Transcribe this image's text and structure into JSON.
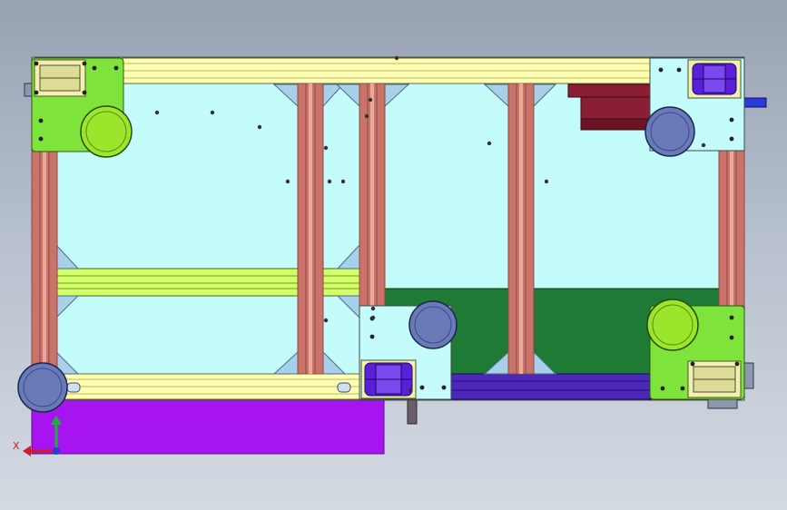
{
  "viewport": {
    "background_top": "#98a2b3",
    "background_bottom": "#d4dae2"
  },
  "model": {
    "view": "top",
    "colors": {
      "plate_cyan": "#c4fbfb",
      "rail_yellow": "#ffffb4",
      "rail_yellow_edge": "#b8b860",
      "crossbar_green": "#d3ff6a",
      "post_brown": "#c9736a",
      "post_brown_dark": "#8a4b44",
      "bracket_blue": "#a8d0e8",
      "motor_bracket_green": "#7ee33a",
      "wheel_green": "#9be62a",
      "wheel_blue": "#6a7ab8",
      "bearing_purple": "#5a1fd8",
      "bearing_yellow": "#f1f0b0",
      "floor_dark_green": "#1e7a34",
      "base_purple": "#a614f0",
      "rail_indigo": "#4b28b8",
      "block_maroon": "#8a1e34",
      "screw_black": "#222222"
    },
    "components": [
      "frame-plate",
      "top-rail",
      "bottom-rail",
      "cross-rail",
      "vertical-posts",
      "corner-brackets",
      "motor-bracket-top-left",
      "motor-bracket-top-right",
      "motor-bracket-bottom-center",
      "motor-bracket-bottom-right",
      "drive-wheels",
      "purple-base-plate",
      "dark-green-floor-panel",
      "indigo-rail-bottom",
      "maroon-block"
    ]
  },
  "triad": {
    "axis_x_label": "X",
    "x_color": "#d61a2a",
    "y_color": "#1cb23a",
    "z_color": "#2a3ad8"
  }
}
